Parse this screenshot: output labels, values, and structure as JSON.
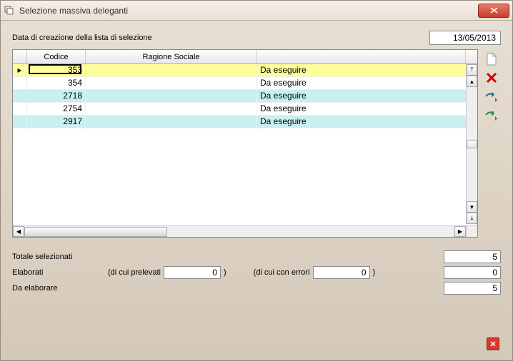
{
  "window": {
    "title": "Selezione massiva deleganti"
  },
  "header": {
    "label": "Data di creazione della lista di selezione",
    "date": "13/05/2013"
  },
  "grid": {
    "columns": {
      "codice": "Codice",
      "ragione": "Ragione Sociale",
      "stato": ""
    },
    "rows": [
      {
        "codice": "353",
        "ragione": "",
        "stato": "Da eseguire",
        "selected": true
      },
      {
        "codice": "354",
        "ragione": "",
        "stato": "Da eseguire",
        "selected": false
      },
      {
        "codice": "2718",
        "ragione": "",
        "stato": "Da eseguire",
        "selected": false
      },
      {
        "codice": "2754",
        "ragione": "",
        "stato": "Da eseguire",
        "selected": false
      },
      {
        "codice": "2917",
        "ragione": "",
        "stato": "Da eseguire",
        "selected": false
      }
    ]
  },
  "summary": {
    "totale_label": "Totale selezionati",
    "totale_value": "5",
    "elaborati_label": "Elaborati",
    "prelevati_label": "(di cui prelevati",
    "prelevati_value": "0",
    "errori_label": "(di cui con errori",
    "errori_value": "0",
    "elaborati_value": "0",
    "daelab_label": "Da elaborare",
    "daelab_value": "5"
  },
  "icons": {
    "new": "new-doc-icon",
    "delete": "delete-icon",
    "export": "export-icon",
    "import": "import-icon"
  }
}
